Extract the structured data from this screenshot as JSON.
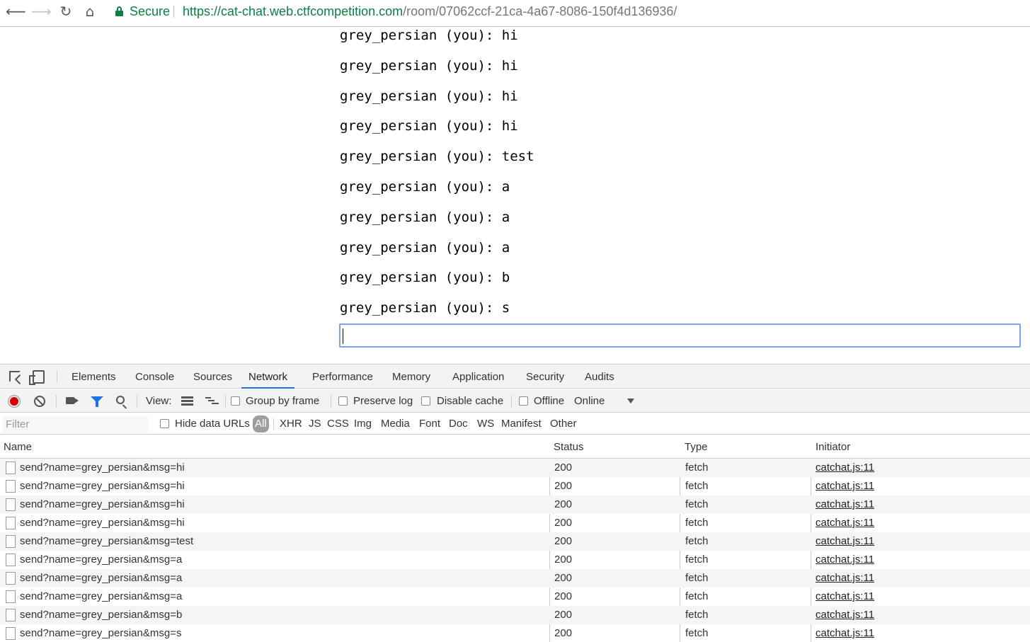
{
  "browser": {
    "nav": {
      "back": "⟵",
      "forward": "⟶",
      "reload": "↻",
      "home": "⌂"
    },
    "secure_label": "Secure",
    "url_origin": "https://cat-chat.web.ctfcompetition.com",
    "url_path": "/room/07062ccf-21ca-4a67-8086-150f4d136936/"
  },
  "chat": {
    "messages": [
      "grey_persian (you): hi",
      "grey_persian (you): hi",
      "grey_persian (you): hi",
      "grey_persian (you): hi",
      "grey_persian (you): test",
      "grey_persian (you): a",
      "grey_persian (you): a",
      "grey_persian (you): a",
      "grey_persian (you): b",
      "grey_persian (you): s"
    ],
    "input_value": ""
  },
  "devtools": {
    "tabs": [
      "Elements",
      "Console",
      "Sources",
      "Network",
      "Performance",
      "Memory",
      "Application",
      "Security",
      "Audits"
    ],
    "active_tab": "Network",
    "toolbar": {
      "view_label": "View:",
      "group_by_frame": "Group by frame",
      "preserve_log": "Preserve log",
      "disable_cache": "Disable cache",
      "offline": "Offline",
      "throttling": "Online"
    },
    "filter": {
      "placeholder": "Filter",
      "hide_data_urls": "Hide data URLs",
      "types": [
        "All",
        "XHR",
        "JS",
        "CSS",
        "Img",
        "Media",
        "Font",
        "Doc",
        "WS",
        "Manifest",
        "Other"
      ],
      "selected_type": "All"
    },
    "table": {
      "headers": {
        "name": "Name",
        "status": "Status",
        "type": "Type",
        "initiator": "Initiator"
      },
      "rows": [
        {
          "name": "send?name=grey_persian&msg=hi",
          "status": "200",
          "type": "fetch",
          "initiator": "catchat.js:11"
        },
        {
          "name": "send?name=grey_persian&msg=hi",
          "status": "200",
          "type": "fetch",
          "initiator": "catchat.js:11"
        },
        {
          "name": "send?name=grey_persian&msg=hi",
          "status": "200",
          "type": "fetch",
          "initiator": "catchat.js:11"
        },
        {
          "name": "send?name=grey_persian&msg=hi",
          "status": "200",
          "type": "fetch",
          "initiator": "catchat.js:11"
        },
        {
          "name": "send?name=grey_persian&msg=test",
          "status": "200",
          "type": "fetch",
          "initiator": "catchat.js:11"
        },
        {
          "name": "send?name=grey_persian&msg=a",
          "status": "200",
          "type": "fetch",
          "initiator": "catchat.js:11"
        },
        {
          "name": "send?name=grey_persian&msg=a",
          "status": "200",
          "type": "fetch",
          "initiator": "catchat.js:11"
        },
        {
          "name": "send?name=grey_persian&msg=a",
          "status": "200",
          "type": "fetch",
          "initiator": "catchat.js:11"
        },
        {
          "name": "send?name=grey_persian&msg=b",
          "status": "200",
          "type": "fetch",
          "initiator": "catchat.js:11"
        },
        {
          "name": "send?name=grey_persian&msg=s",
          "status": "200",
          "type": "fetch",
          "initiator": "catchat.js:11"
        }
      ]
    }
  },
  "colors": {
    "secure": "#0b8043",
    "accent": "#1a73e8",
    "record": "#d60000"
  }
}
